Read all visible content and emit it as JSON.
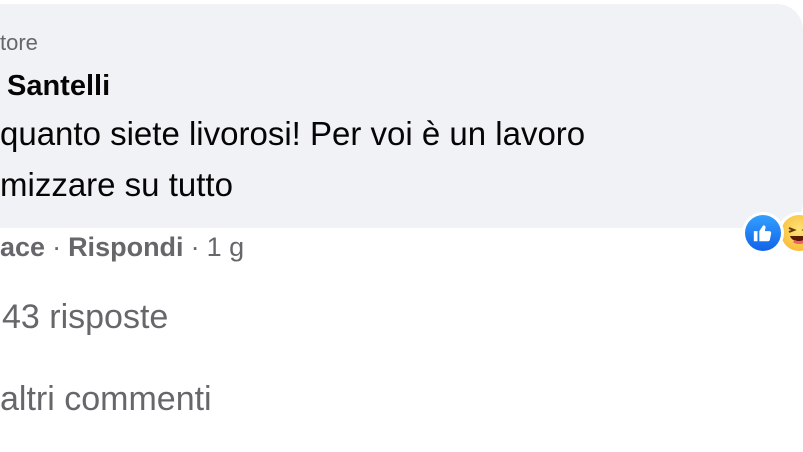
{
  "comment": {
    "role_label": "tore",
    "author": "Santelli",
    "text_line1": "quanto siete livorosi! Per voi è un lavoro",
    "text_line2": "mizzare su tutto"
  },
  "reactions": [
    {
      "icon": "like-reaction-icon",
      "color": "#1877f2"
    },
    {
      "icon": "haha-reaction-icon",
      "color": "#f7b125"
    }
  ],
  "actions": {
    "like_label": "ace",
    "separator": "·",
    "reply_label": "Rispondi",
    "timestamp": "1 g"
  },
  "replies_link": "43 risposte",
  "more_comments_link": "altri commenti",
  "colors": {
    "bubble_bg": "#f0f2f5",
    "primary_text": "#050505",
    "secondary_text": "#65676b",
    "like_blue": "#1877f2"
  }
}
